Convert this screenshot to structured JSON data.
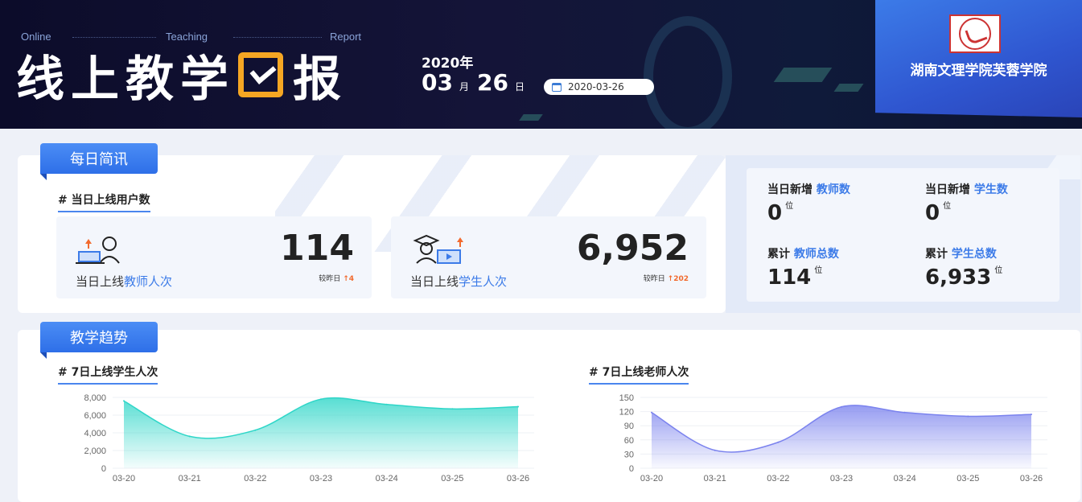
{
  "header": {
    "en_words": [
      "Online",
      "Teaching",
      "Report"
    ],
    "title_part1": "线上教学",
    "title_part2": "报",
    "year": "2020年",
    "month": "03",
    "month_unit": "月",
    "day": "26",
    "day_unit": "日",
    "date_picker_value": "2020-03-26",
    "school_name": "湖南文理学院芙蓉学院"
  },
  "daily": {
    "tab_label": "每日简讯",
    "heading": "# 当日上线用户数",
    "teacher": {
      "label_prefix": "当日上线",
      "label_hl": "教师人次",
      "value": "114",
      "compare_label": "较昨日",
      "delta": "↑4"
    },
    "student": {
      "label_prefix": "当日上线",
      "label_hl": "学生人次",
      "value": "6,952",
      "compare_label": "较昨日",
      "delta": "↑202"
    },
    "panel": {
      "new_teacher": {
        "prefix": "当日新增",
        "hl": "教师数",
        "value": "0",
        "unit": "位"
      },
      "new_student": {
        "prefix": "当日新增",
        "hl": "学生数",
        "value": "0",
        "unit": "位"
      },
      "total_teacher": {
        "prefix": "累计",
        "hl": "教师总数",
        "value": "114",
        "unit": "位"
      },
      "total_student": {
        "prefix": "累计",
        "hl": "学生总数",
        "value": "6,933",
        "unit": "位"
      }
    }
  },
  "trend": {
    "tab_label": "教学趋势",
    "student_heading": "# 7日上线学生人次",
    "teacher_heading": "# 7日上线老师人次"
  },
  "colors": {
    "accent": "#3c7be8",
    "student_line": "#2ed6c8",
    "teacher_line": "#7b83ee",
    "up": "#f26a2e",
    "calendar_icon": "#f5a623"
  },
  "chart_data": [
    {
      "type": "area",
      "title": "# 7日上线学生人次",
      "categories": [
        "03-20",
        "03-21",
        "03-22",
        "03-23",
        "03-24",
        "03-25",
        "03-26"
      ],
      "series": [
        {
          "values": [
            7600,
            3600,
            4300,
            7800,
            7200,
            6700,
            6952
          ]
        }
      ],
      "yticks": [
        "0",
        "2,000",
        "4,000",
        "6,000",
        "8,000"
      ],
      "ylim": [
        0,
        8000
      ],
      "grid": true,
      "legend": "none"
    },
    {
      "type": "area",
      "title": "# 7日上线老师人次",
      "categories": [
        "03-20",
        "03-21",
        "03-22",
        "03-23",
        "03-24",
        "03-25",
        "03-26"
      ],
      "series": [
        {
          "values": [
            118,
            38,
            55,
            130,
            118,
            110,
            114
          ]
        }
      ],
      "yticks": [
        "0",
        "30",
        "60",
        "90",
        "120",
        "150"
      ],
      "ylim": [
        0,
        150
      ],
      "grid": true,
      "legend": "none"
    }
  ]
}
